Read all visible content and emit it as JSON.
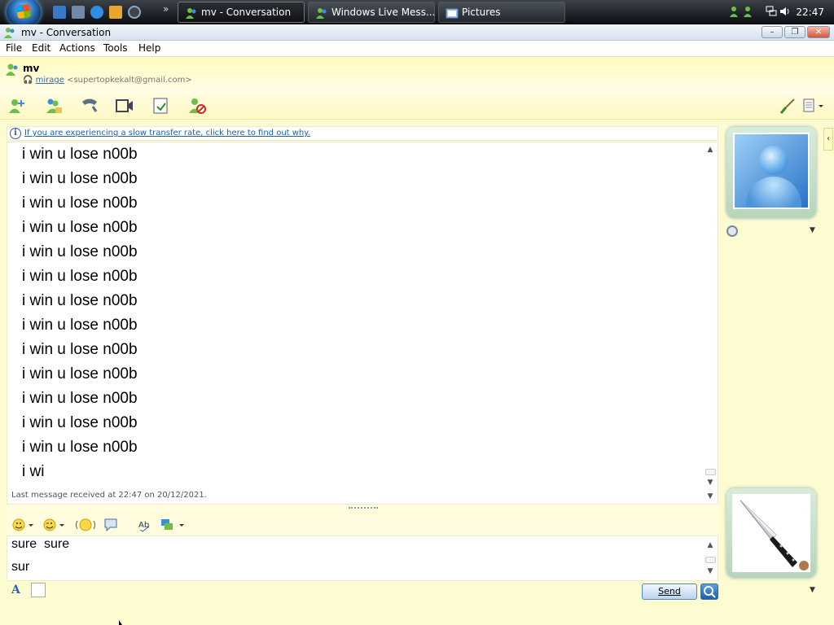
{
  "taskbar": {
    "tasks": [
      {
        "label": "mv - Conversation"
      },
      {
        "label": "Windows Live Mess..."
      },
      {
        "label": "Pictures"
      }
    ],
    "quicklaunch_more": "»",
    "clock": "22:47"
  },
  "window": {
    "title": "mv - Conversation",
    "buttons": {
      "minimize": "–",
      "maximize": "❐",
      "close": "✕"
    }
  },
  "menu": {
    "items": [
      {
        "label": "File"
      },
      {
        "label": "Edit"
      },
      {
        "label": "Actions"
      },
      {
        "label": "Tools"
      },
      {
        "label": "Help"
      }
    ]
  },
  "contact": {
    "name": "mv",
    "personal_message": "mirage",
    "email": "<supertopkekalt@gmail.com>"
  },
  "toolbar": {
    "icons": [
      "invite-contact-icon",
      "share-files-icon",
      "call-icon",
      "video-call-icon",
      "activities-icon",
      "block-contact-icon",
      "paint-brush-icon",
      "options-menu-icon"
    ]
  },
  "info_bar": {
    "text": "If you are experiencing a slow transfer rate, click here to find out why."
  },
  "conversation": {
    "messages": [
      "i win u lose n00b",
      "i win u lose n00b",
      "i win u lose n00b",
      "i win u lose n00b",
      "i win u lose n00b",
      "i win u lose n00b",
      "i win u lose n00b",
      "i win u lose n00b",
      "i win u lose n00b",
      "i win u lose n00b",
      "i win u lose n00b",
      "i win u lose n00b",
      "i win u lose n00b",
      "i wi"
    ],
    "last_message_status": "Last message received at 22:47 on 20/12/2021."
  },
  "input": {
    "lines": [
      "sure  sure",
      "sur"
    ],
    "toolbar_icons": [
      "emoticon-icon",
      "wink-icon",
      "voice-clip-icon",
      "nudge-icon",
      "spell-check-icon",
      "games-icon"
    ]
  },
  "actions": {
    "send_label": "Send"
  },
  "colors": {
    "background": "#fdfbd0",
    "link": "#1c5fb4",
    "accent_yellow": "#fff9c4"
  }
}
